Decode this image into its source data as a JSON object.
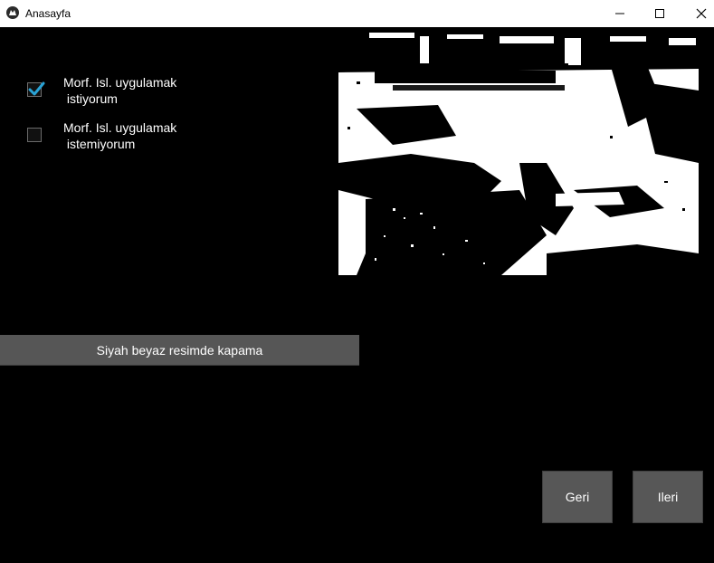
{
  "window": {
    "title": "Anasayfa",
    "icons": {
      "app": "kivy-logo-icon",
      "minimize": "minimize-icon",
      "maximize": "maximize-icon",
      "close": "close-icon"
    }
  },
  "options": [
    {
      "label": "Morf. Isl. uygulamak\n istiyorum",
      "checked": true
    },
    {
      "label": "Morf. Isl. uygulamak\n istemiyorum",
      "checked": false
    }
  ],
  "preview": {
    "description_icon": "binary-image-preview"
  },
  "actions": {
    "closing_button": "Siyah beyaz resimde kapama",
    "back_button": "Geri",
    "next_button": "Ileri"
  },
  "colors": {
    "background": "#000000",
    "button": "#575757",
    "checkmark": "#29a3d6"
  }
}
